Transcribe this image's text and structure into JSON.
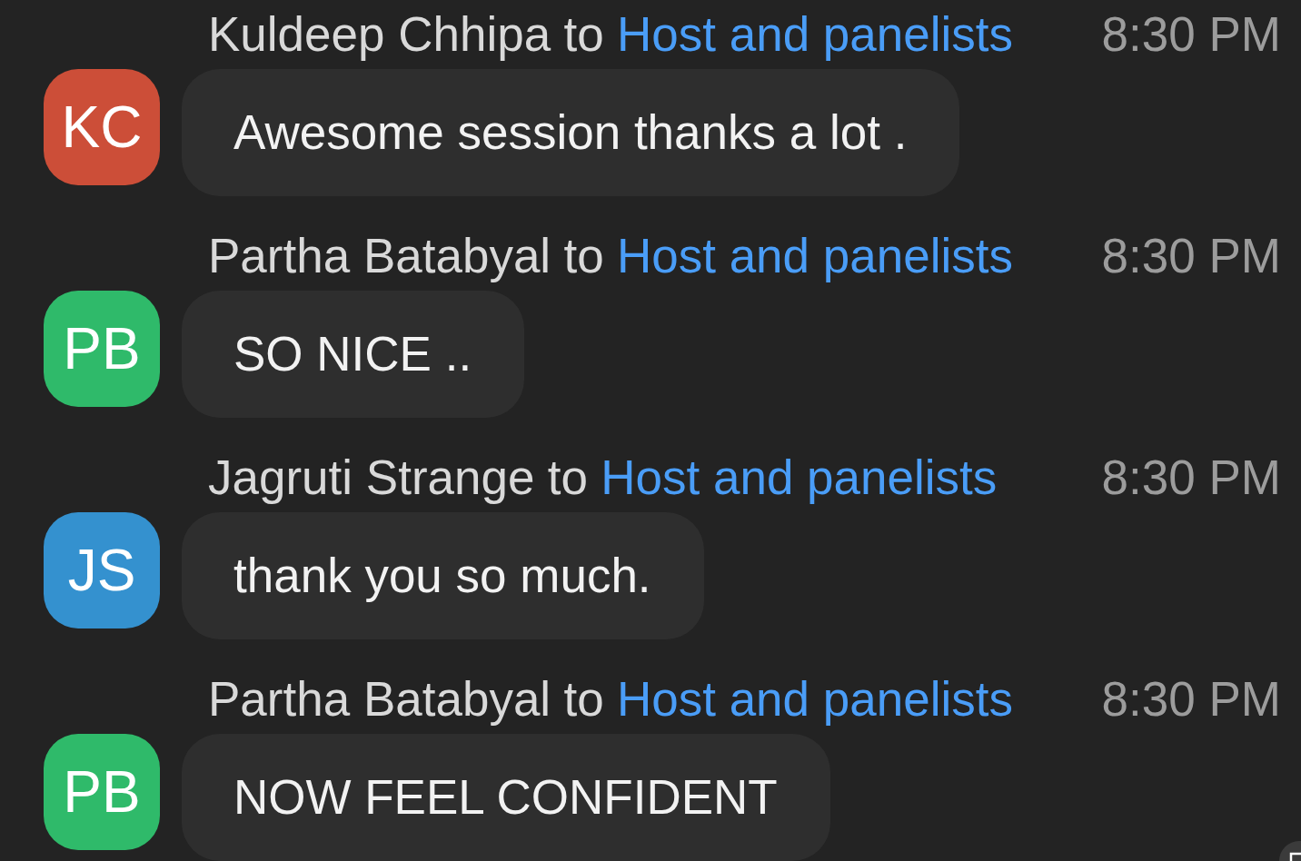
{
  "messages": [
    {
      "initials": "KC",
      "color": "#cc4e38",
      "sender": "Kuldeep Chhipa",
      "connector": "to",
      "recipient": "Host and panelists",
      "time": "8:30 PM",
      "text": "Awesome session thanks a lot ."
    },
    {
      "initials": "PB",
      "color": "#2fba6a",
      "sender": "Partha Batabyal",
      "connector": "to",
      "recipient": "Host and panelists",
      "time": "8:30 PM",
      "text": "SO NICE .."
    },
    {
      "initials": "JS",
      "color": "#3491cf",
      "sender": "Jagruti Strange",
      "connector": "to",
      "recipient": "Host and panelists",
      "time": "8:30 PM",
      "text": "thank you so much."
    },
    {
      "initials": "PB",
      "color": "#2fba6a",
      "sender": "Partha Batabyal",
      "connector": "to",
      "recipient": "Host and panelists",
      "time": "8:30 PM",
      "text": "NOW FEEL CONFIDENT"
    }
  ]
}
